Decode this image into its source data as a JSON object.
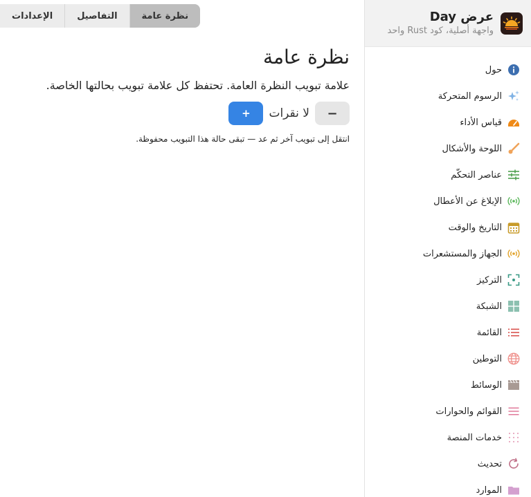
{
  "app": {
    "title": "عرض Day",
    "subtitle": "واجهة أصلية، كود Rust واحد"
  },
  "sidebar": {
    "items": [
      {
        "label": "حول",
        "icon": "info-icon"
      },
      {
        "label": "الرسوم المتحركة",
        "icon": "sparkles-icon"
      },
      {
        "label": "قياس الأداء",
        "icon": "speedometer-icon"
      },
      {
        "label": "اللوحة والأشكال",
        "icon": "paintbrush-icon"
      },
      {
        "label": "عناصر التحكّم",
        "icon": "sliders-icon"
      },
      {
        "label": "الإبلاغ عن الأعطال",
        "icon": "broadcast-icon"
      },
      {
        "label": "التاريخ والوقت",
        "icon": "calendar-icon"
      },
      {
        "label": "الجهاز والمستشعرات",
        "icon": "sensor-icon"
      },
      {
        "label": "التركيز",
        "icon": "focus-icon"
      },
      {
        "label": "الشبكة",
        "icon": "grid-icon"
      },
      {
        "label": "القائمة",
        "icon": "list-icon"
      },
      {
        "label": "التوطين",
        "icon": "globe-icon"
      },
      {
        "label": "الوسائط",
        "icon": "clapperboard-icon"
      },
      {
        "label": "القوائم والحوارات",
        "icon": "menu-icon"
      },
      {
        "label": "خدمات المنصة",
        "icon": "dots-grid-icon"
      },
      {
        "label": "تحديث",
        "icon": "refresh-icon"
      },
      {
        "label": "الموارد",
        "icon": "folder-icon"
      }
    ]
  },
  "tabs": [
    {
      "label": "نظرة عامة",
      "active": true
    },
    {
      "label": "التفاصيل",
      "active": false
    },
    {
      "label": "الإعدادات",
      "active": false
    }
  ],
  "main": {
    "title": "نظرة عامة",
    "description": "علامة تبويب النظرة العامة. تحتفظ كل علامة تبويب بحالتها الخاصة.",
    "minus_label": "−",
    "counter_text": "لا نقرات",
    "plus_label": "+",
    "hint": "انتقل إلى تبويب آخر ثم عد — تبقى حالة هذا التبويب محفوظة."
  },
  "colors": {
    "accent": "#3584e4",
    "active_tab": "#bdbdbd",
    "tab_bar": "#ececec",
    "header_bg": "#f2f2f2"
  }
}
